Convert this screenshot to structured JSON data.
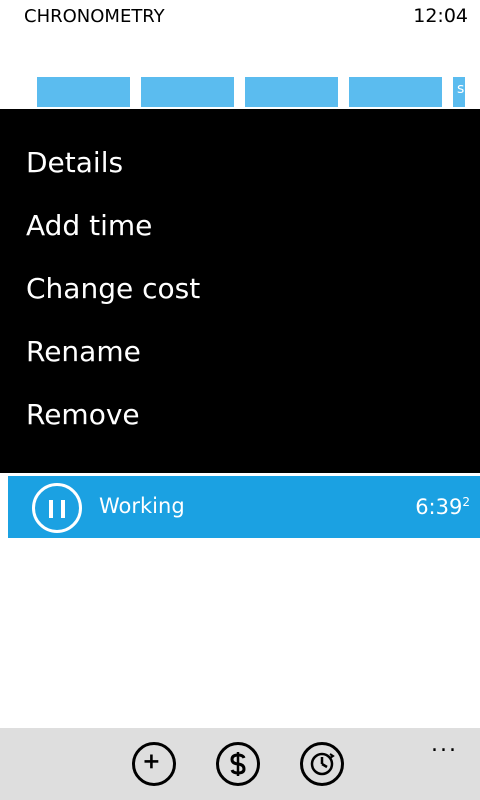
{
  "status": {
    "app_title": "CHRONOMETRY",
    "time": "12:04"
  },
  "tiles": {
    "count": 5,
    "color": "#5bbcef",
    "partial_glyph": "s"
  },
  "context_menu": {
    "items": [
      {
        "label": "Details"
      },
      {
        "label": "Add time"
      },
      {
        "label": "Change cost"
      },
      {
        "label": "Rename"
      },
      {
        "label": "Remove"
      }
    ]
  },
  "timer": {
    "label": "Working",
    "time_main": "6:39",
    "time_sub": "2",
    "state_icon": "pause-icon",
    "color": "#1ba1e2"
  },
  "app_bar": {
    "buttons": [
      {
        "icon": "add-icon"
      },
      {
        "icon": "dollar-icon"
      },
      {
        "icon": "reset-clock-icon"
      }
    ],
    "more_label": "..."
  }
}
